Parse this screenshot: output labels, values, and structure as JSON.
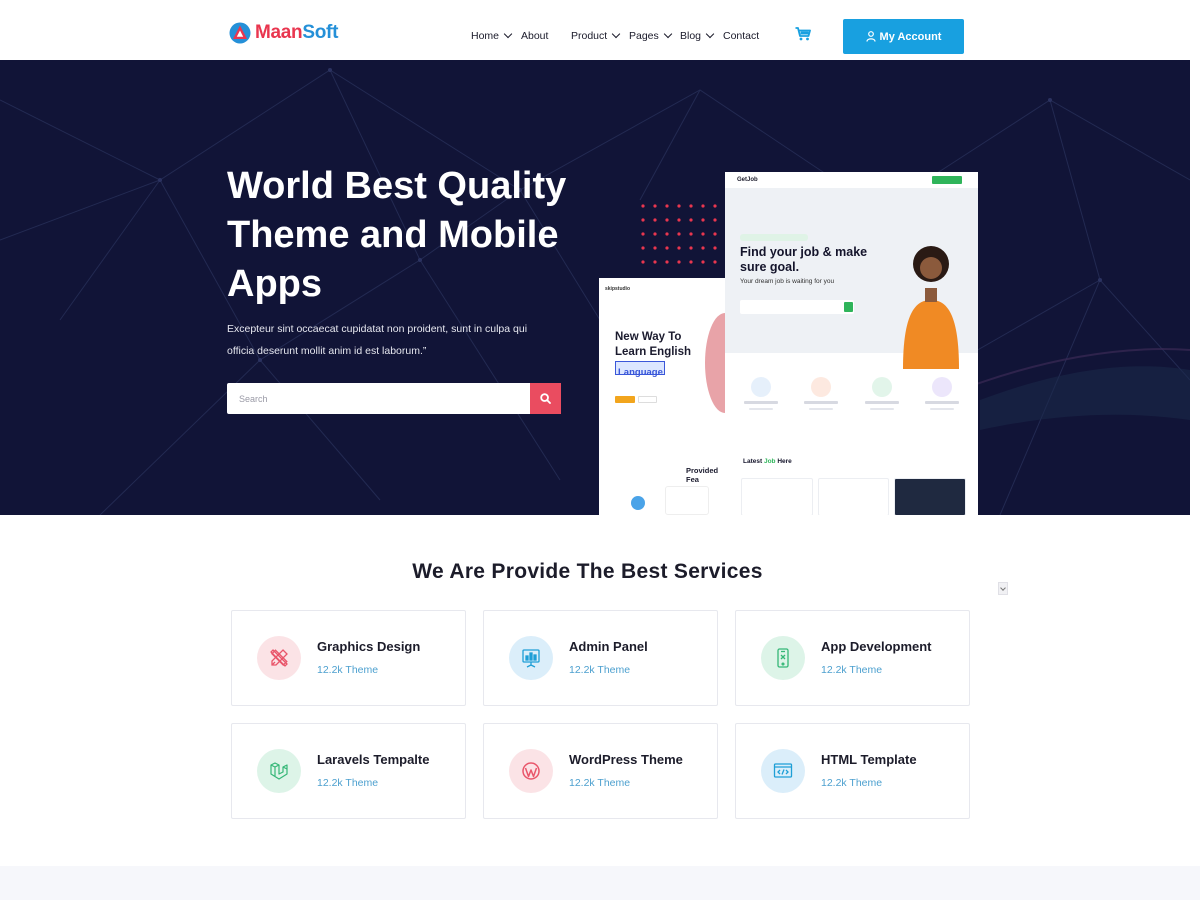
{
  "header": {
    "logo": {
      "part1": "Maan",
      "part2": "Soft"
    },
    "nav": [
      {
        "label": "Home",
        "has_dropdown": true
      },
      {
        "label": "About",
        "has_dropdown": false
      },
      {
        "label": "Product",
        "has_dropdown": true
      },
      {
        "label": "Pages",
        "has_dropdown": true
      },
      {
        "label": "Blog",
        "has_dropdown": true
      },
      {
        "label": "Contact",
        "has_dropdown": false
      }
    ],
    "cart_icon": "cart-icon",
    "account_button": {
      "label": "My Account",
      "icon": "user-icon"
    }
  },
  "hero": {
    "title": "World Best Quality Theme and Mobile Apps",
    "description": "Excepteur sint occaecat cupidatat non proident, sunt in culpa qui officia deserunt mollit anim id est laborum.”",
    "search": {
      "placeholder": "Search",
      "button_icon": "search-icon"
    },
    "mockup_job": {
      "logo": "GetJob",
      "headline": "Find your job & make sure goal.",
      "subline": "Your dream job is waiting for you",
      "latest_label": "Latest",
      "latest_highlight": "Job",
      "latest_suffix": "Here"
    },
    "mockup_english": {
      "brand": "skipstudio",
      "headline": "New Way To Learn English",
      "highlight": "Language",
      "provided_label": "Provided Fea"
    }
  },
  "services": {
    "title": "We Are Provide The Best Services",
    "items": [
      {
        "title": "Graphics Design",
        "subtitle": "12.2k Theme",
        "icon": "design-tools-icon",
        "color": "#e9556a",
        "bg": "#fbe3e6"
      },
      {
        "title": "Admin Panel",
        "subtitle": "12.2k Theme",
        "icon": "presentation-board-icon",
        "color": "#1f9fd6",
        "bg": "#dbeefa"
      },
      {
        "title": "App Development",
        "subtitle": "12.2k Theme",
        "icon": "smartphone-icon",
        "color": "#35b777",
        "bg": "#ddf4e8"
      },
      {
        "title": "Laravels Tempalte",
        "subtitle": "12.2k Theme",
        "icon": "laravel-icon",
        "color": "#35b777",
        "bg": "#ddf4e8"
      },
      {
        "title": "WordPress Theme",
        "subtitle": "12.2k Theme",
        "icon": "wordpress-icon",
        "color": "#e9556a",
        "bg": "#fbe3e6"
      },
      {
        "title": "HTML Template",
        "subtitle": "12.2k Theme",
        "icon": "code-window-icon",
        "color": "#1f9fd6",
        "bg": "#dbeefa"
      }
    ]
  },
  "colors": {
    "brand_red": "#e9364f",
    "brand_blue": "#2590d8",
    "account_button": "#18a0e0",
    "hero_bg": "#111437",
    "search_button": "#ea4c60",
    "subtitle_text": "#4da0cf"
  }
}
